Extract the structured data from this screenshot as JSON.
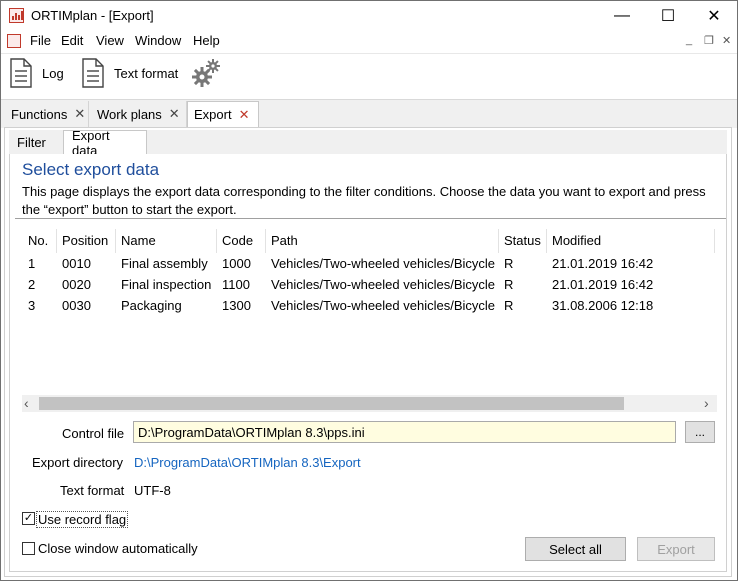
{
  "window": {
    "title": "ORTIMplan - [Export]",
    "controls": {
      "minimize": "—",
      "maximize": "☐",
      "close": "✕"
    }
  },
  "menu": {
    "items": [
      "File",
      "Edit",
      "View",
      "Window",
      "Help"
    ],
    "mdi": {
      "minimize": "_",
      "restore": "❐",
      "close": "✕"
    }
  },
  "toolbar": {
    "log_label": "Log",
    "text_format_label": "Text format",
    "settings_icon": "gears-icon"
  },
  "tabs": [
    {
      "label": "Functions",
      "close": "✕"
    },
    {
      "label": "Work plans",
      "close": "✕"
    },
    {
      "label": "Export",
      "close": "✕",
      "active": true
    }
  ],
  "inner_tabs": [
    {
      "label": "Filter"
    },
    {
      "label": "Export data",
      "active": true
    }
  ],
  "section": {
    "title": "Select export data",
    "description": "This page displays the export data corresponding to the filter conditions. Choose the data you want to export and press the “export” button to start the export."
  },
  "table": {
    "columns": [
      "No.",
      "Position",
      "Name",
      "Code",
      "Path",
      "Status",
      "Modified"
    ],
    "rows": [
      [
        "1",
        "0010",
        "Final assembly",
        "1000",
        "Vehicles/Two-wheeled vehicles/Bicycle",
        "R",
        "21.01.2019 16:42"
      ],
      [
        "2",
        "0020",
        "Final inspection",
        "1100",
        "Vehicles/Two-wheeled vehicles/Bicycle",
        "R",
        "21.01.2019 16:42"
      ],
      [
        "3",
        "0030",
        "Packaging",
        "1300",
        "Vehicles/Two-wheeled vehicles/Bicycle",
        "R",
        "31.08.2006 12:18"
      ]
    ],
    "scroll_left": "‹",
    "scroll_right": "›"
  },
  "form": {
    "control_file_label": "Control file",
    "control_file_value": "D:\\ProgramData\\ORTIMplan 8.3\\pps.ini",
    "browse_label": "...",
    "export_dir_label": "Export directory",
    "export_dir_value": "D:\\ProgramData\\ORTIMplan 8.3\\Export",
    "text_format_label": "Text format",
    "text_format_value": "UTF-8",
    "use_record_flag_label": "Use record flag",
    "use_record_flag_checked": "✓",
    "close_window_label": "Close window automatically"
  },
  "buttons": {
    "select_all": "Select all",
    "export": "Export"
  },
  "colors": {
    "accent": "#1f4e9c",
    "link": "#1565c0",
    "input_bg": "#fffde0",
    "close_active": "#c0392b"
  }
}
